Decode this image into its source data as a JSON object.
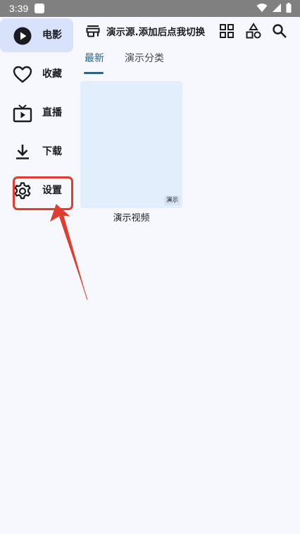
{
  "status_bar": {
    "time": "3:39"
  },
  "sidebar": {
    "items": [
      {
        "label": "电影",
        "icon": "play-circle-icon",
        "active": true
      },
      {
        "label": "收藏",
        "icon": "heart-icon",
        "active": false
      },
      {
        "label": "直播",
        "icon": "tv-icon",
        "active": false
      },
      {
        "label": "下载",
        "icon": "download-icon",
        "active": false
      },
      {
        "label": "设置",
        "icon": "gear-icon",
        "active": false
      }
    ]
  },
  "topbar": {
    "source_title": "演示源.添加后点我切换",
    "icons": [
      "source-icon",
      "grid-icon",
      "category-icon",
      "search-icon"
    ]
  },
  "tabs": [
    {
      "label": "最新",
      "active": true
    },
    {
      "label": "演示分类",
      "active": false
    }
  ],
  "videos": [
    {
      "title": "演示视频",
      "badge": "演示"
    }
  ],
  "colors": {
    "background": "#f7f8fe",
    "active_nav": "#d8e2fb",
    "accent": "#2e6387",
    "annotation": "#e03d2f",
    "thumb": "#e3eefc"
  }
}
